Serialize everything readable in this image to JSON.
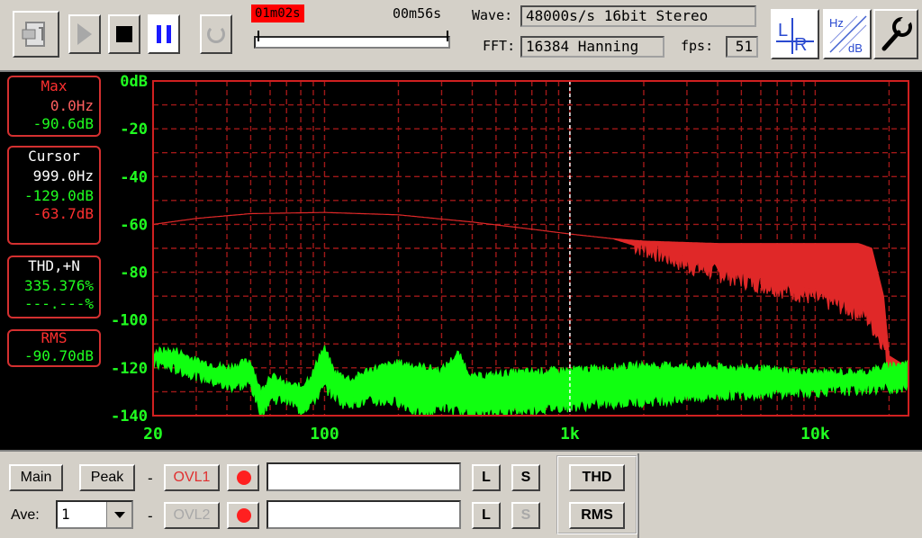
{
  "toolbar": {
    "time_elapsed": "01m02s",
    "time_remaining": "00m56s",
    "wave_label": "Wave:",
    "wave_value": "48000s/s 16bit Stereo",
    "fft_label": "FFT:",
    "fft_value": "16384 Hanning",
    "fps_label": "fps:",
    "fps_value": "51",
    "playback_progress": 0.02,
    "lr_icon_text": [
      "L",
      "R"
    ],
    "hzdb_icon_text": [
      "Hz",
      "dB"
    ]
  },
  "sidebar": {
    "max": {
      "title": "Max",
      "freq": "0.0Hz",
      "level": "-90.6dB"
    },
    "cursor": {
      "title": "Cursor",
      "freq": "999.0Hz",
      "level_green": "-129.0dB",
      "level_red": "-63.7dB"
    },
    "thd": {
      "title": "THD,+N",
      "value_green": "335.376%",
      "value_dim": "---.---%"
    },
    "rms": {
      "title": "RMS",
      "value": "-90.70dB"
    }
  },
  "bottom": {
    "main_label": "Main",
    "peak_label": "Peak",
    "ave_label": "Ave:",
    "ave_value": "1",
    "dash": "-",
    "ovl1_label": "OVL1",
    "ovl2_label": "OVL2",
    "l_label": "L",
    "s_label": "S",
    "thd_label": "THD",
    "rms_label": "RMS"
  },
  "colors": {
    "red_series": "#e02828",
    "green_series": "#10ff10",
    "grid": "#a01818",
    "axis_text": "#20ff20",
    "panel_border": "#d43030"
  },
  "chart_data": {
    "type": "area",
    "x_scale": "log",
    "xlim": [
      20,
      24000
    ],
    "ylim": [
      -140,
      0
    ],
    "y_ticks": [
      "0dB",
      "-20",
      "-40",
      "-60",
      "-80",
      "-100",
      "-120",
      "-140"
    ],
    "y_tick_values": [
      0,
      -20,
      -40,
      -60,
      -80,
      -100,
      -120,
      -140
    ],
    "x_ticks": [
      "20",
      "100",
      "1k",
      "10k"
    ],
    "x_tick_values": [
      20,
      100,
      1000,
      10000
    ],
    "cursor_x": 1000,
    "grid": true,
    "series": [
      {
        "color": "#e02828",
        "upper": [
          [
            20,
            -60
          ],
          [
            30,
            -57.5
          ],
          [
            50,
            -55.5
          ],
          [
            100,
            -55
          ],
          [
            200,
            -56
          ],
          [
            400,
            -59
          ],
          [
            700,
            -62
          ],
          [
            1000,
            -64
          ],
          [
            1500,
            -66
          ],
          [
            2000,
            -67
          ],
          [
            4000,
            -68
          ],
          [
            8000,
            -68
          ],
          [
            15000,
            -68
          ],
          [
            17000,
            -70
          ],
          [
            19000,
            -90
          ],
          [
            20000,
            -115
          ],
          [
            24000,
            -120
          ]
        ],
        "lower": [
          [
            20,
            -60
          ],
          [
            30,
            -57.5
          ],
          [
            50,
            -55.5
          ],
          [
            100,
            -55
          ],
          [
            200,
            -56
          ],
          [
            400,
            -59
          ],
          [
            700,
            -62
          ],
          [
            1000,
            -64
          ],
          [
            1500,
            -66
          ],
          [
            2000,
            -70
          ],
          [
            3000,
            -77
          ],
          [
            5000,
            -83
          ],
          [
            8000,
            -88
          ],
          [
            12000,
            -93
          ],
          [
            16000,
            -98
          ],
          [
            19000,
            -110
          ],
          [
            20000,
            -123
          ],
          [
            24000,
            -124
          ]
        ]
      },
      {
        "color": "#10ff10",
        "upper": [
          [
            20,
            -113
          ],
          [
            25,
            -113
          ],
          [
            30,
            -117
          ],
          [
            40,
            -120
          ],
          [
            50,
            -117
          ],
          [
            55,
            -130
          ],
          [
            60,
            -123
          ],
          [
            70,
            -127
          ],
          [
            80,
            -128
          ],
          [
            90,
            -122
          ],
          [
            95,
            -115
          ],
          [
            100,
            -112
          ],
          [
            110,
            -122
          ],
          [
            130,
            -125
          ],
          [
            150,
            -121
          ],
          [
            200,
            -118
          ],
          [
            300,
            -121
          ],
          [
            350,
            -114
          ],
          [
            400,
            -124
          ],
          [
            600,
            -122
          ],
          [
            1000,
            -121
          ],
          [
            2000,
            -119
          ],
          [
            5000,
            -120
          ],
          [
            10000,
            -122
          ],
          [
            16000,
            -122
          ],
          [
            20000,
            -119
          ],
          [
            24000,
            -118
          ]
        ],
        "lower": [
          [
            20,
            -118
          ],
          [
            30,
            -123
          ],
          [
            40,
            -128
          ],
          [
            50,
            -127
          ],
          [
            55,
            -140
          ],
          [
            60,
            -133
          ],
          [
            70,
            -133
          ],
          [
            80,
            -138
          ],
          [
            90,
            -134
          ],
          [
            100,
            -128
          ],
          [
            120,
            -135
          ],
          [
            150,
            -134
          ],
          [
            200,
            -134
          ],
          [
            250,
            -140
          ],
          [
            300,
            -136
          ],
          [
            400,
            -140
          ],
          [
            600,
            -138
          ],
          [
            1000,
            -136
          ],
          [
            2000,
            -134
          ],
          [
            5000,
            -131
          ],
          [
            10000,
            -130
          ],
          [
            24000,
            -128
          ]
        ]
      }
    ]
  }
}
